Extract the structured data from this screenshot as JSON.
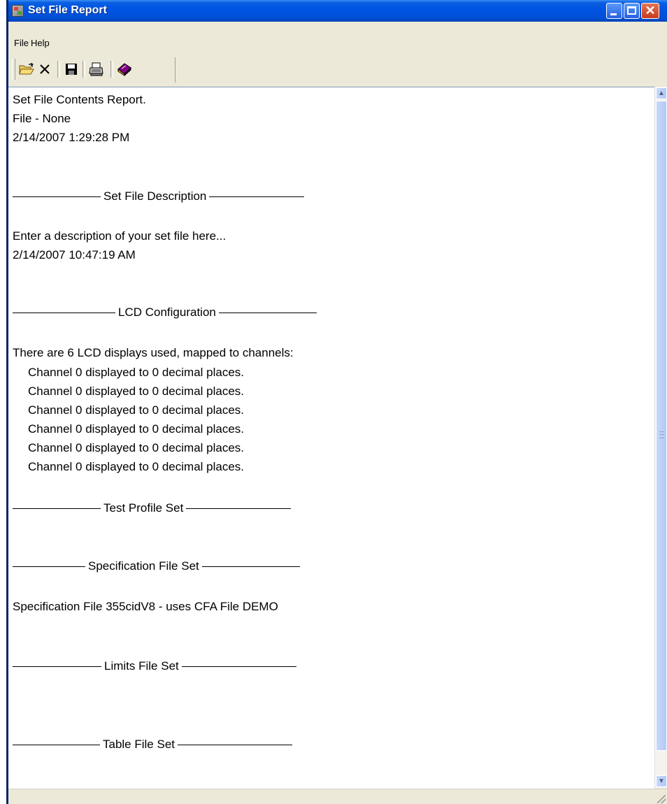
{
  "window": {
    "title": "Set File Report"
  },
  "menu": {
    "file_label": "File",
    "help_label": "Help"
  },
  "toolbar": {
    "buttons": [
      "open-folder-icon",
      "close-x-icon",
      "save-disk-icon",
      "print-icon",
      "book-icon"
    ]
  },
  "report": {
    "header": {
      "title": "Set File Contents Report.",
      "file": "File - None",
      "timestamp": "2/14/2007 1:29:28 PM"
    },
    "set_file_description": {
      "heading": "Set File Description",
      "text": "Enter a description of your set file here...",
      "timestamp": "2/14/2007 10:47:19 AM"
    },
    "lcd_configuration": {
      "heading": "LCD Configuration",
      "intro": "There are 6 LCD displays used, mapped to channels:",
      "channels": [
        "Channel 0 displayed to 0 decimal places.",
        "Channel 0 displayed to 0 decimal places.",
        "Channel 0 displayed to 0 decimal places.",
        "Channel 0 displayed to 0 decimal places.",
        "Channel 0 displayed to 0 decimal places.",
        "Channel 0 displayed to 0 decimal places."
      ]
    },
    "test_profile_set": {
      "heading": "Test Profile Set"
    },
    "specification_file_set": {
      "heading": "Specification File Set",
      "text": "Specification File 355cidV8 - uses CFA File DEMO"
    },
    "limits_file_set": {
      "heading": "Limits File Set"
    },
    "table_file_set": {
      "heading": "Table File Set"
    }
  },
  "colors": {
    "titlebar": "#0054e3",
    "chrome": "#ece9d8",
    "report_bg": "#ffffff"
  }
}
